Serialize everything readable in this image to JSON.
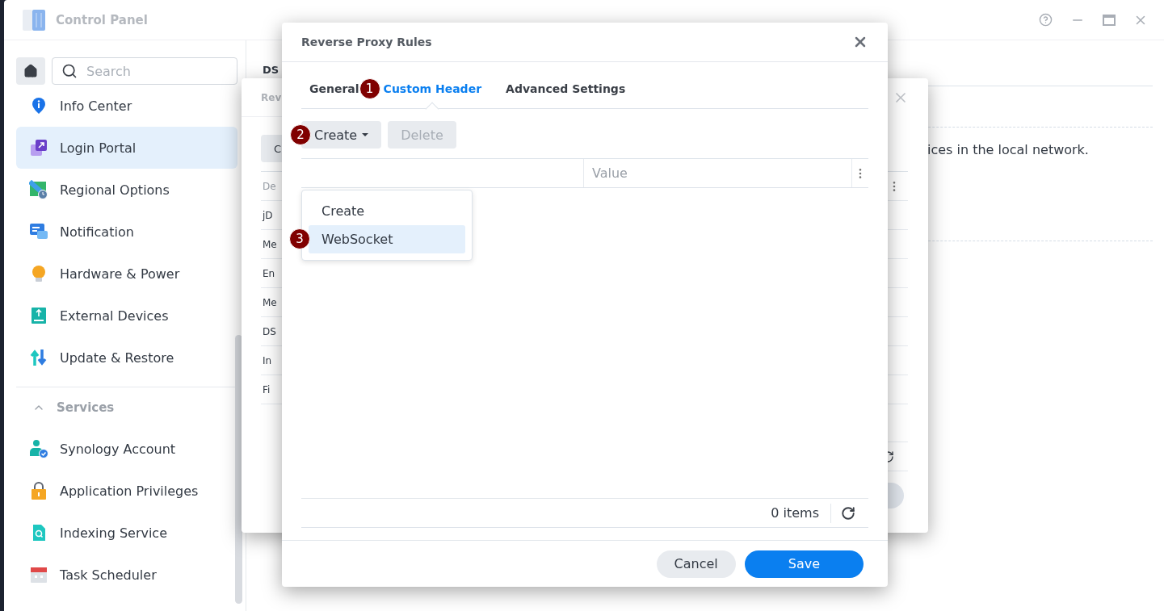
{
  "window": {
    "title": "Control Panel"
  },
  "sidebar": {
    "search": {
      "placeholder": "Search"
    },
    "items": [
      {
        "label": "Info Center",
        "selected": false
      },
      {
        "label": "Login Portal",
        "selected": true
      },
      {
        "label": "Regional Options",
        "selected": false
      },
      {
        "label": "Notification",
        "selected": false
      },
      {
        "label": "Hardware & Power",
        "selected": false
      },
      {
        "label": "External Devices",
        "selected": false
      },
      {
        "label": "Update & Restore",
        "selected": false
      }
    ],
    "section": {
      "label": "Services",
      "expanded": true,
      "items": [
        {
          "label": "Synology Account",
          "selected": false
        },
        {
          "label": "Application Privileges",
          "selected": false
        },
        {
          "label": "Indexing Service",
          "selected": false
        },
        {
          "label": "Task Scheduler",
          "selected": false
        }
      ]
    }
  },
  "content": {
    "heading": "DS",
    "text": "ices in the local network."
  },
  "background_dialog": {
    "title": "Rev",
    "button": "C",
    "column_header": "De",
    "rows": [
      "jD",
      "Me",
      "En",
      "Me",
      "DS",
      "In",
      "Fi"
    ]
  },
  "dialog": {
    "title": "Reverse Proxy Rules",
    "tabs": [
      {
        "label": "General",
        "selected": false
      },
      {
        "label": "Custom Header",
        "selected": true,
        "marker": "1"
      },
      {
        "label": "Advanced Settings",
        "selected": false
      }
    ],
    "toolbar": [
      {
        "label": "Create",
        "kind": "dropdown",
        "disabled": false,
        "marker": "2"
      },
      {
        "label": "Delete",
        "kind": "plain",
        "disabled": true
      }
    ],
    "columns": [
      "Value"
    ],
    "menu": [
      {
        "label": "Create",
        "selected": false
      },
      {
        "label": "WebSocket",
        "selected": true,
        "marker": "3"
      }
    ],
    "item_count": "0 items",
    "buttons": [
      {
        "label": "Cancel",
        "kind": "secondary"
      },
      {
        "label": "Save",
        "kind": "primary"
      }
    ]
  }
}
